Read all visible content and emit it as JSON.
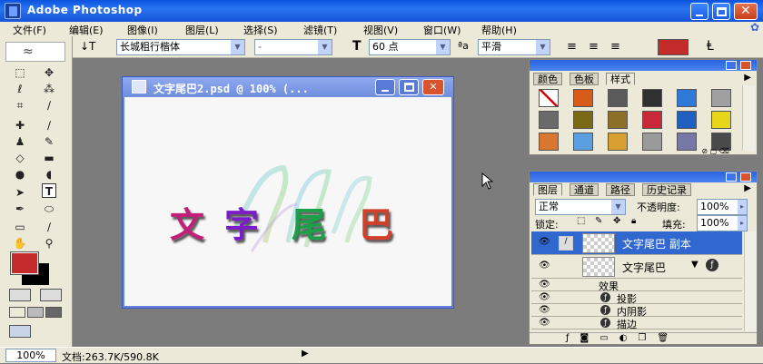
{
  "window": {
    "title": "Adobe Photoshop"
  },
  "menu": [
    "文件(F)",
    "编辑(E)",
    "图像(I)",
    "图层(L)",
    "选择(S)",
    "滤镜(T)",
    "视图(V)",
    "窗口(W)",
    "帮助(H)"
  ],
  "options": {
    "font_family": "长城粗行楷体",
    "font_style": "-",
    "font_size": "60 点",
    "antialias": "平滑",
    "text_color": "#c42b2b"
  },
  "toolbox": {
    "foreground": "#c42b2b",
    "background": "#000000"
  },
  "document": {
    "title": "文字尾巴2.psd @ 100% (...",
    "text_chars": [
      "文",
      "字",
      "尾",
      "巴"
    ],
    "char_colors": [
      "#c0207a",
      "#7a1cc8",
      "#1aa048",
      "#d0402a"
    ]
  },
  "styles_panel": {
    "tabs": [
      "颜色",
      "色板",
      "样式"
    ],
    "swatch_colors": [
      "#ffffff",
      "#d85a18",
      "#5a5a5a",
      "#303030",
      "#2f7ad8",
      "#a0a0a0",
      "#6a6a6a",
      "#7a6a18",
      "#8a7028",
      "#c82838",
      "#2060c0",
      "#e8d418",
      "#d87830",
      "#5aa0e0",
      "#d8a030",
      "#9a9a9a",
      "#7878a8",
      "#4a4a4a"
    ]
  },
  "layers_panel": {
    "tabs": [
      "图层",
      "通道",
      "路径",
      "历史记录"
    ],
    "blend_mode": "正常",
    "opacity_label": "不透明度:",
    "opacity": "100%",
    "lock_label": "锁定:",
    "fill_label": "填充:",
    "fill": "100%",
    "layers": [
      {
        "name": "文字尾巴 副本",
        "selected": true
      },
      {
        "name": "文字尾巴",
        "selected": false
      }
    ],
    "effects_label": "效果",
    "effects": [
      "投影",
      "内阴影",
      "描边"
    ]
  },
  "status": {
    "zoom": "100%",
    "doc_info": "文档:263.7K/590.8K"
  }
}
